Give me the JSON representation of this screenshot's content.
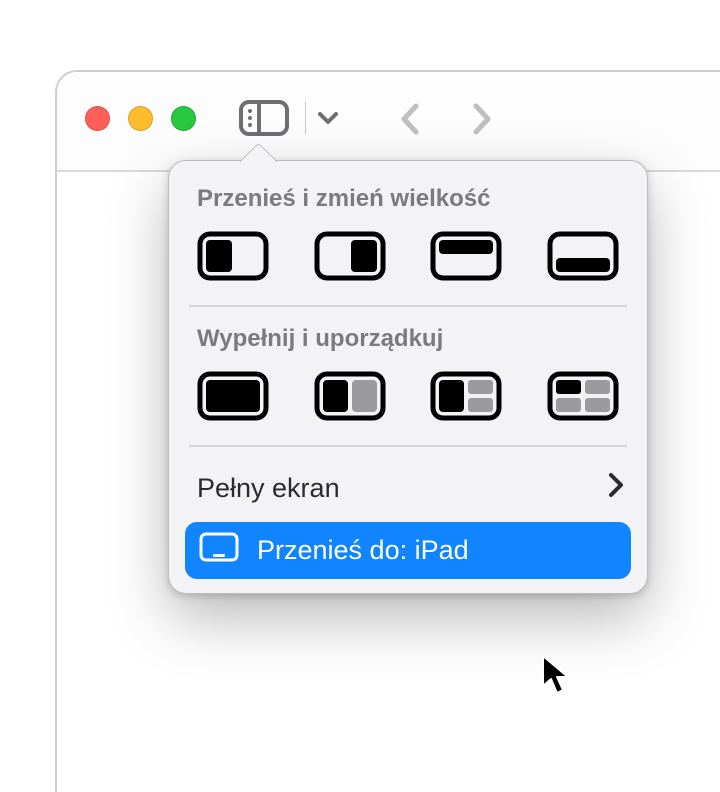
{
  "menu": {
    "section_move_resize": "Przenieś i zmień wielkość",
    "section_fill_arrange": "Wypełnij i uporządkuj",
    "full_screen": "Pełny ekran",
    "move_to": "Przenieś do: iPad"
  }
}
